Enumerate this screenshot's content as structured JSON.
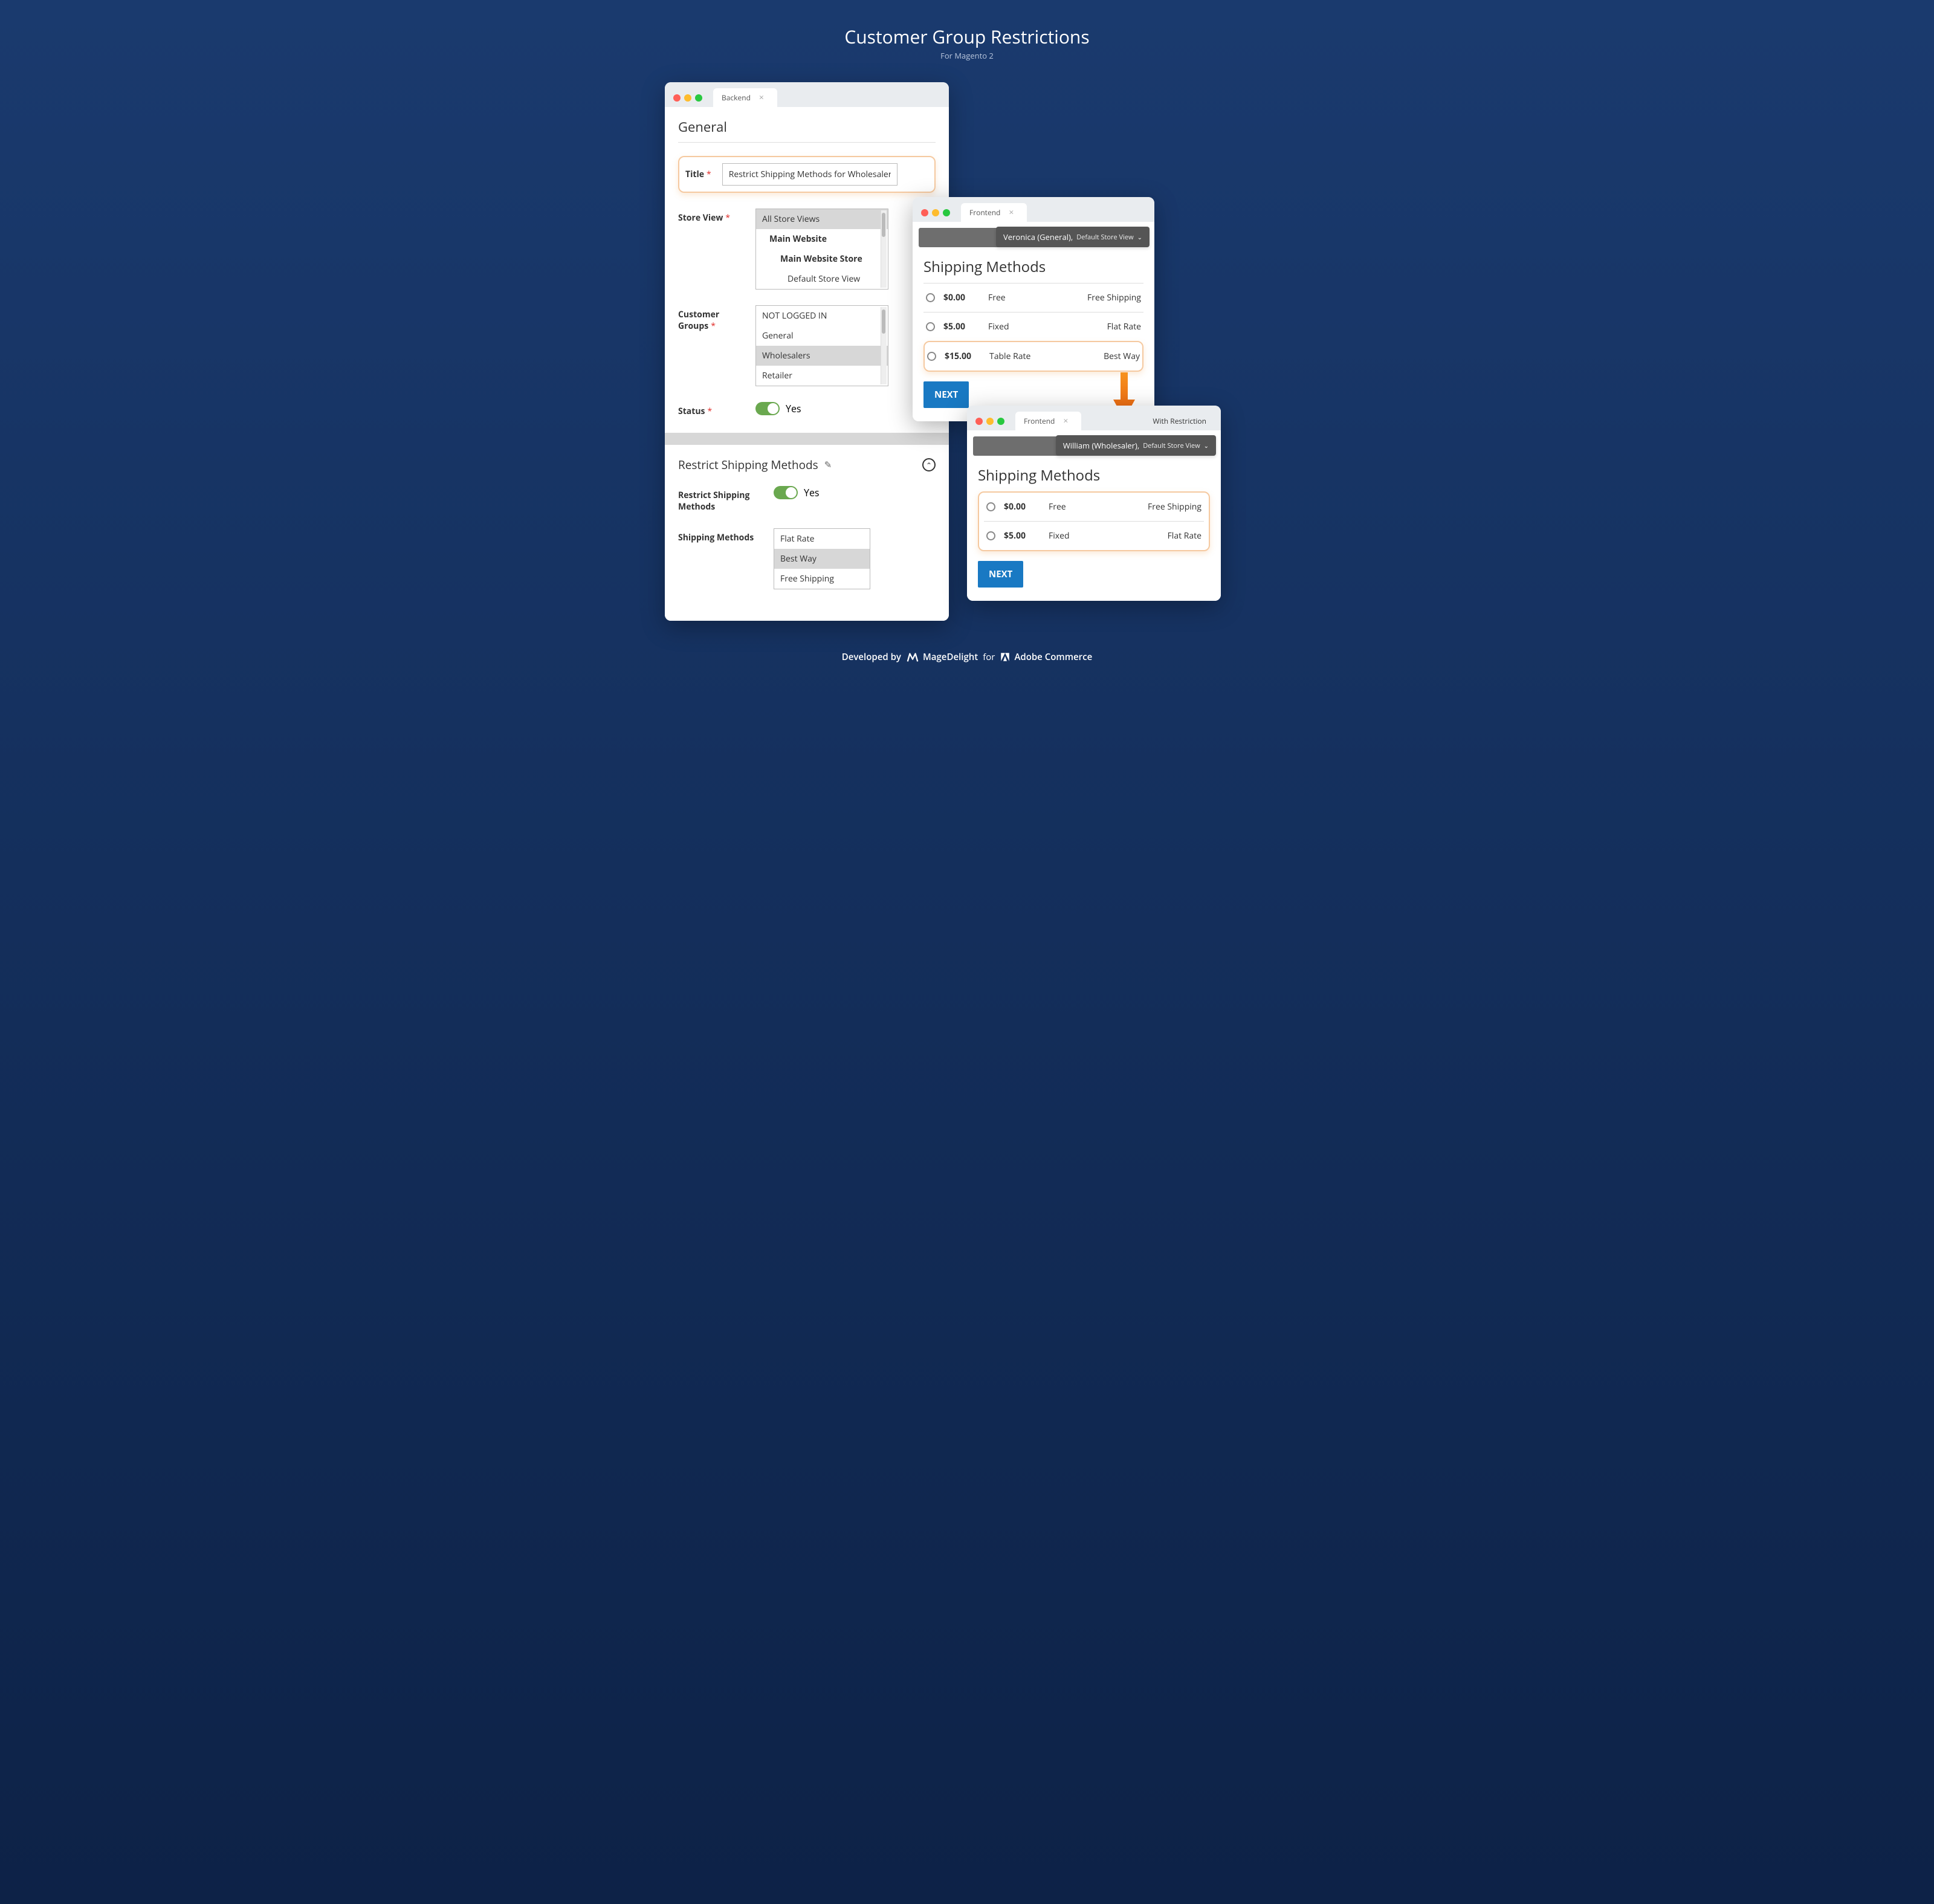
{
  "page": {
    "title": "Customer Group Restrictions",
    "subtitle": "For Magento 2"
  },
  "backend": {
    "tab_label": "Backend",
    "section_general": "General",
    "title_label": "Title",
    "title_value": "Restrict Shipping Methods for Wholesaler",
    "store_view_label": "Store View",
    "store_view_options": [
      "All Store Views",
      "Main Website",
      "Main Website Store",
      "Default Store View"
    ],
    "customer_groups_label": "Customer Groups",
    "customer_groups_options": [
      "NOT LOGGED IN",
      "General",
      "Wholesalers",
      "Retailer"
    ],
    "customer_groups_selected": "Wholesalers",
    "status_label": "Status",
    "status_value": "Yes",
    "section_restrict": "Restrict Shipping Methods",
    "restrict_toggle_label": "Restrict Shipping Methods",
    "restrict_toggle_value": "Yes",
    "shipping_methods_label": "Shipping Methods",
    "shipping_methods_options": [
      "Flat Rate",
      "Best Way",
      "Free Shipping"
    ],
    "shipping_methods_selected": "Best Way"
  },
  "frontend1": {
    "tab_label": "Frontend",
    "user": "Veronica (General),",
    "store": "Default Store View",
    "heading": "Shipping Methods",
    "rows": [
      {
        "price": "$0.00",
        "type": "Free",
        "carrier": "Free Shipping"
      },
      {
        "price": "$5.00",
        "type": "Fixed",
        "carrier": "Flat Rate"
      },
      {
        "price": "$15.00",
        "type": "Table Rate",
        "carrier": "Best Way"
      }
    ],
    "next": "NEXT"
  },
  "frontend2": {
    "tab_label": "Frontend",
    "right_label": "With Restriction",
    "user": "William (Wholesaler),",
    "store": "Default Store View",
    "heading": "Shipping Methods",
    "rows": [
      {
        "price": "$0.00",
        "type": "Free",
        "carrier": "Free Shipping"
      },
      {
        "price": "$5.00",
        "type": "Fixed",
        "carrier": "Flat Rate"
      }
    ],
    "next": "NEXT"
  },
  "footer": {
    "dev_by": "Developed by",
    "brand": "MageDelight",
    "for": "for",
    "platform": "Adobe Commerce"
  }
}
